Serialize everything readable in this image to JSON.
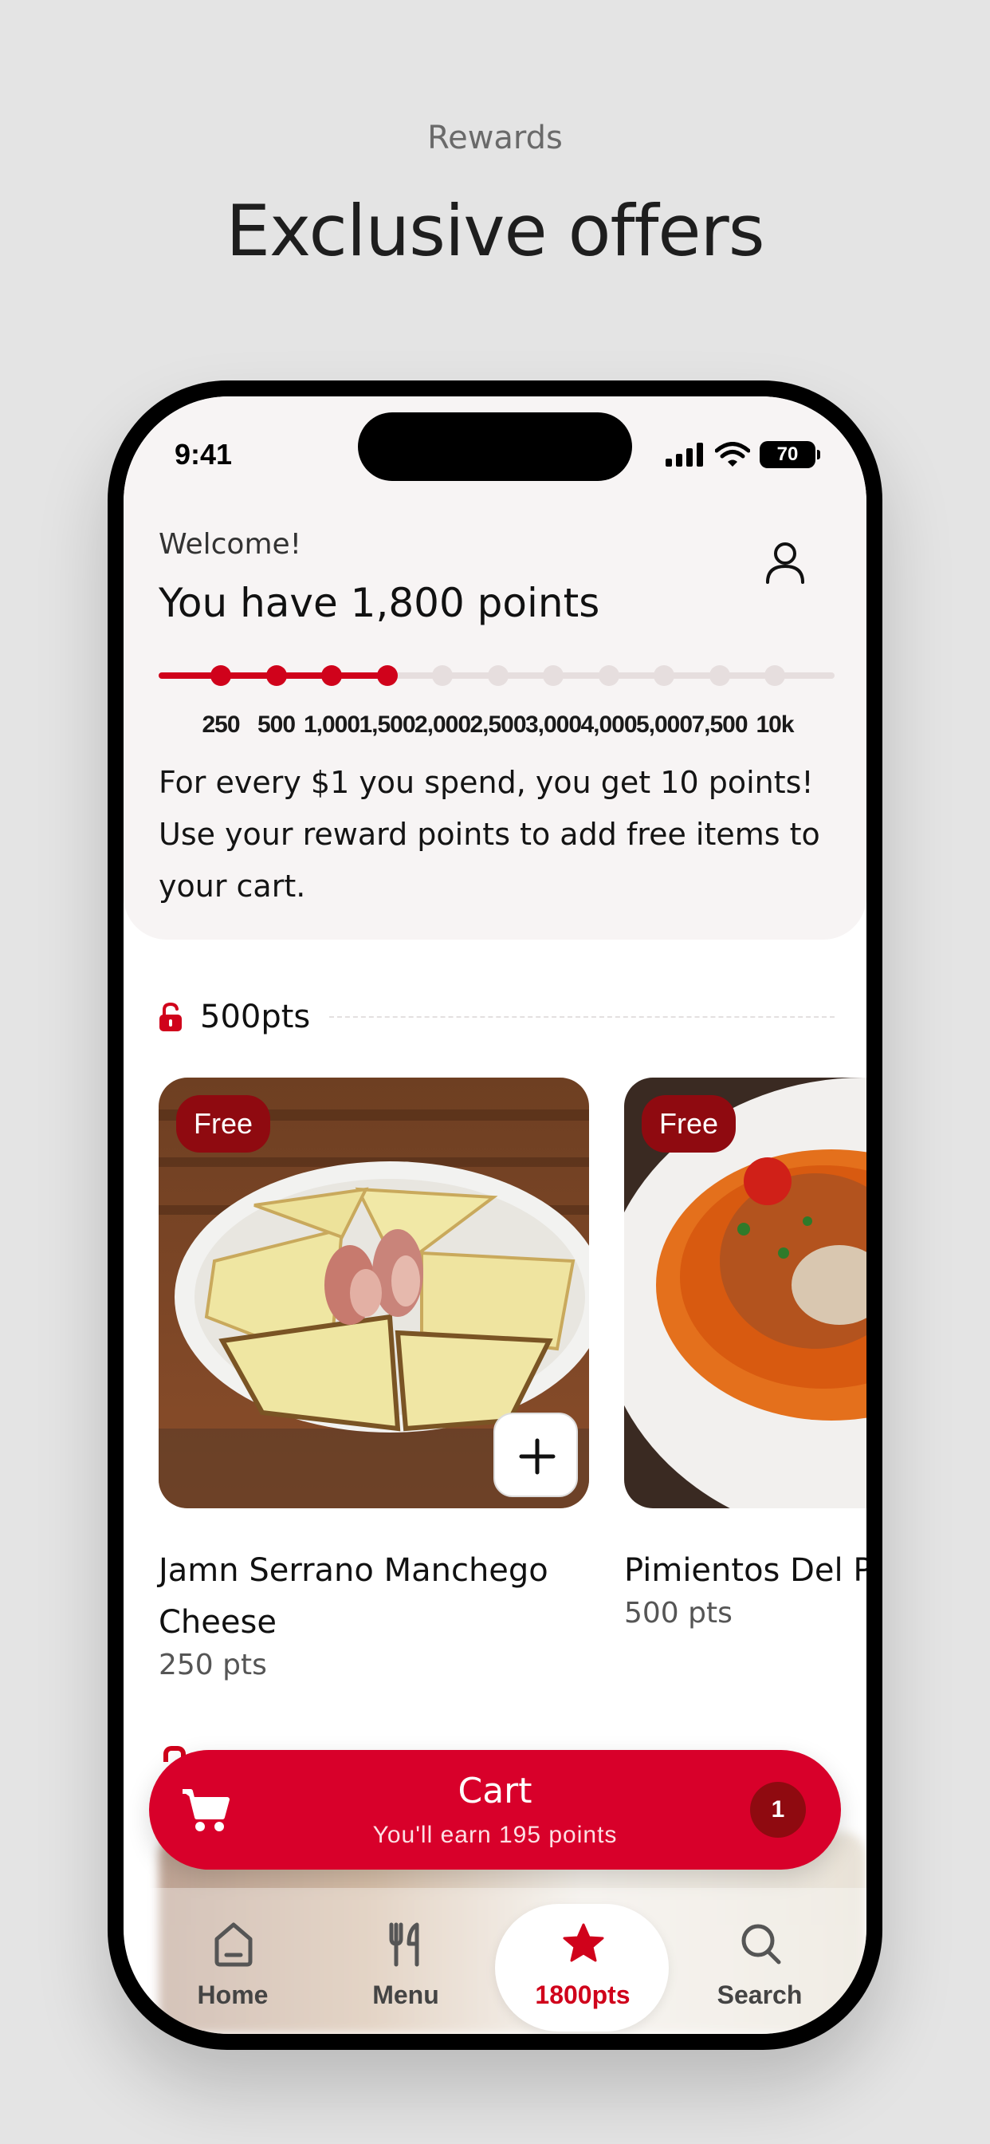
{
  "page": {
    "eyebrow": "Rewards",
    "title": "Exclusive offers"
  },
  "status_bar": {
    "time": "9:41",
    "battery": "70"
  },
  "header": {
    "welcome": "Welcome!",
    "points_title": "You have 1,800 points",
    "profile_icon": "person-icon"
  },
  "progress": {
    "current_points": 1800,
    "milestones": [
      "250",
      "500",
      "1,000",
      "1,500",
      "2,000",
      "2,500",
      "3,000",
      "4,000",
      "5,000",
      "7,500",
      "10k"
    ],
    "reached_count": 4
  },
  "info": {
    "text": "For every $1 you spend, you get 10 points! Use your reward points to add free items to your cart."
  },
  "tier": {
    "label": "500pts",
    "icon": "unlock-icon"
  },
  "items": [
    {
      "badge": "Free",
      "name": "Jamn Serrano Manchego Cheese",
      "points": "250 pts"
    },
    {
      "badge": "Free",
      "name": "Pimientos Del P",
      "points": "500 pts"
    }
  ],
  "cart": {
    "title": "Cart",
    "subtitle": "You'll earn 195 points",
    "count": "1",
    "icon": "cart-icon"
  },
  "tabs": [
    {
      "label": "Home",
      "icon": "home-icon"
    },
    {
      "label": "Menu",
      "icon": "utensils-icon"
    },
    {
      "label": "1800pts",
      "icon": "star-icon"
    },
    {
      "label": "Search",
      "icon": "search-icon"
    }
  ],
  "colors": {
    "accent": "#d0021b",
    "badge": "#8f0a10"
  }
}
